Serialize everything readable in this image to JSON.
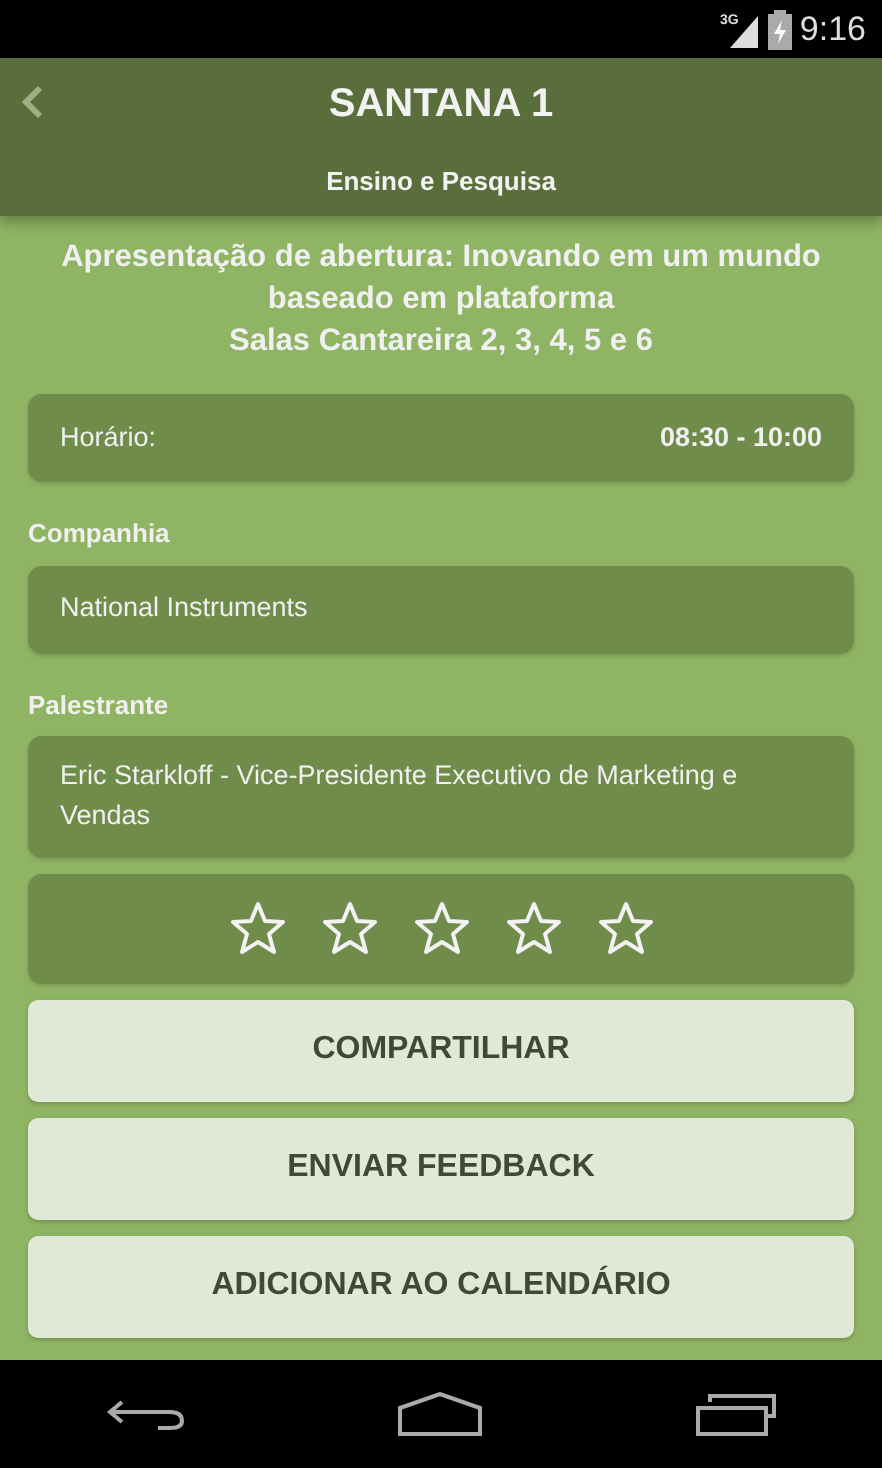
{
  "status_bar": {
    "network": "3G",
    "time": "9:16"
  },
  "app_bar": {
    "title": "SANTANA 1",
    "subtitle": "Ensino e Pesquisa"
  },
  "session": {
    "title": "Apresentação de abertura: Inovando em um mundo baseado em plataforma",
    "room": "Salas Cantareira 2, 3, 4, 5 e 6"
  },
  "schedule": {
    "label": "Horário:",
    "value": "08:30 - 10:00"
  },
  "fields": [
    {
      "label": "Companhia",
      "value": "National Instruments"
    },
    {
      "label": "Palestrante",
      "value": "Eric Starkloff - Vice-Presidente Executivo de Marketing e Vendas"
    }
  ],
  "rating": {
    "stars": 0
  },
  "buttons": [
    "COMPARTILHAR",
    "ENVIAR FEEDBACK",
    "ADICIONAR AO CALENDÁRIO"
  ]
}
